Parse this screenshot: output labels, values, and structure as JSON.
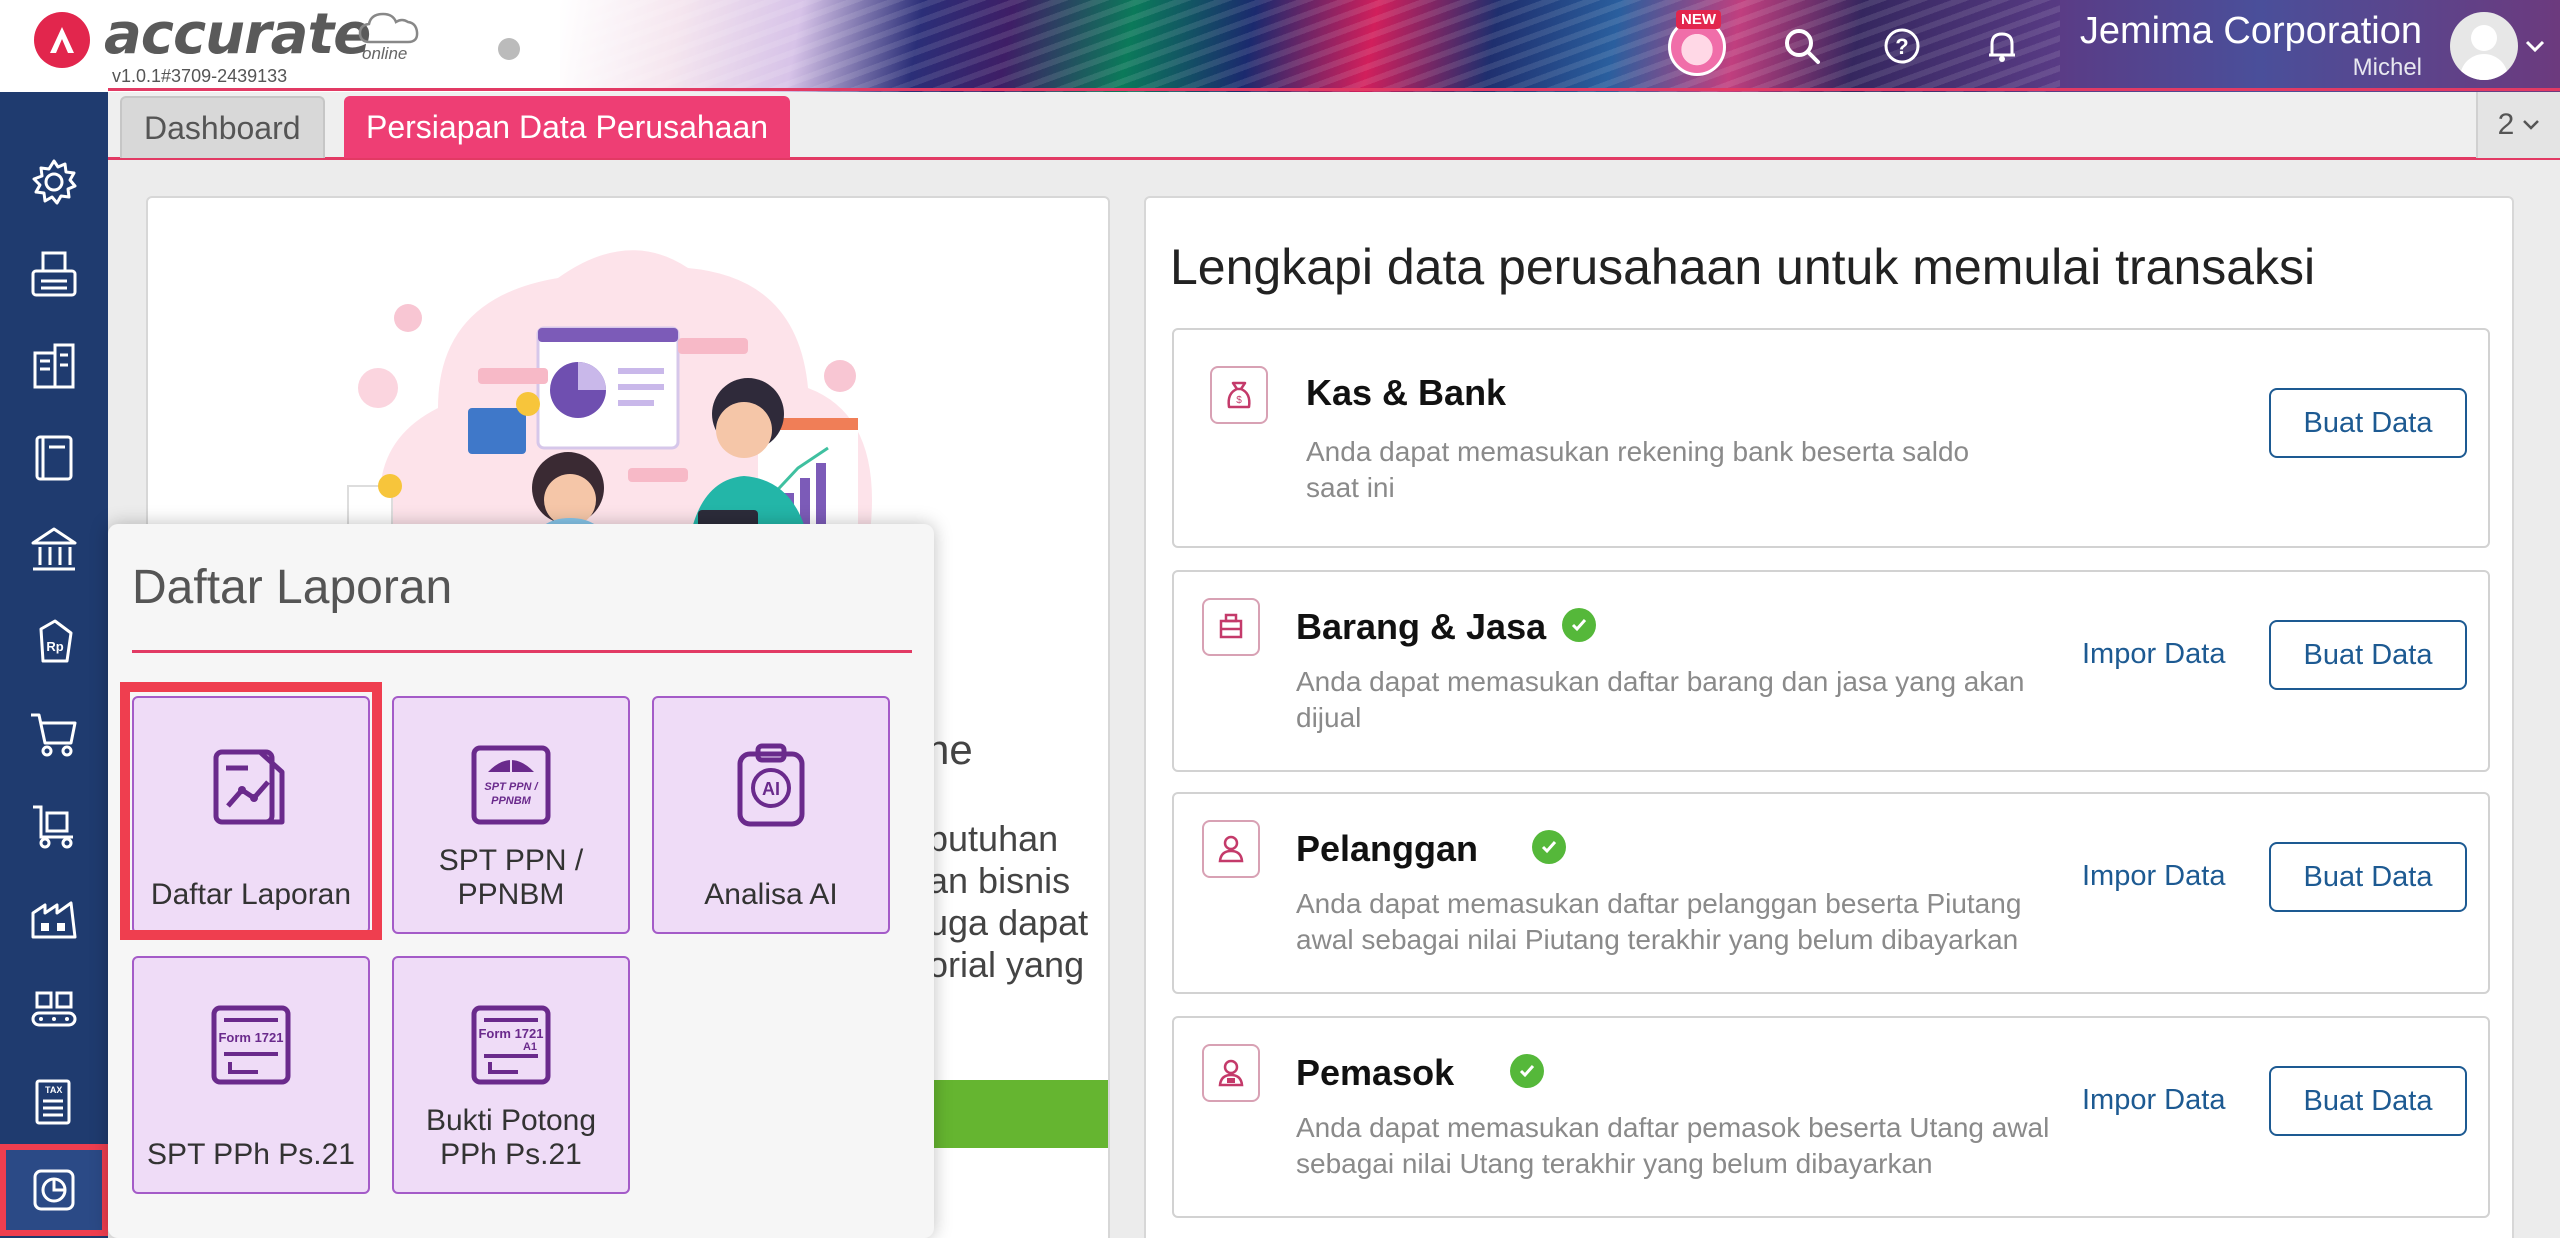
{
  "header": {
    "brand": "accurate",
    "brand_sub": "online",
    "version": "v1.0.1#3709-2439133",
    "new_badge": "NEW",
    "company": "Jemima Corporation",
    "user": "Michel"
  },
  "sidebar": {
    "items": [
      "gear-icon",
      "fax-icon",
      "building-icon",
      "book-icon",
      "bank-icon",
      "price-tag-icon",
      "cart-icon",
      "delivery-cart-icon",
      "factory-icon",
      "conveyor-icon",
      "tax-form-icon",
      "report-chart-icon"
    ]
  },
  "tabs": {
    "items": [
      {
        "label": "Dashboard"
      },
      {
        "label": "Persiapan Data Perusahaan"
      }
    ],
    "count": "2"
  },
  "left_card": {
    "partial_title": "ne",
    "partial_lines": [
      "butuhan",
      "an bisnis",
      "uga dapat",
      "orial yang"
    ]
  },
  "right_card": {
    "title": "Lengkapi data perusahaan untuk memulai transaksi",
    "entries": [
      {
        "title": "Kas & Bank",
        "desc": "Anda dapat memasukan rekening bank beserta saldo saat ini",
        "impor": "",
        "buat": "Buat Data"
      },
      {
        "title": "Barang & Jasa",
        "desc": "Anda dapat memasukan daftar barang dan jasa yang akan dijual",
        "impor": "Impor Data",
        "buat": "Buat Data"
      },
      {
        "title": "Pelanggan",
        "desc": "Anda dapat memasukan daftar pelanggan beserta Piutang awal sebagai nilai Piutang terakhir yang belum dibayarkan",
        "impor": "Impor Data",
        "buat": "Buat Data"
      },
      {
        "title": "Pemasok",
        "desc": "Anda dapat memasukan daftar pemasok beserta Utang awal sebagai nilai Utang terakhir yang belum dibayarkan",
        "impor": "Impor Data",
        "buat": "Buat Data"
      }
    ]
  },
  "popup": {
    "title": "Daftar Laporan",
    "tiles": [
      {
        "label": "Daftar Laporan",
        "icon": "report-chart-icon"
      },
      {
        "label": "SPT PPN / PPNBM",
        "icon": "spt-ppn-icon",
        "icon_text_1": "SPT PPN /",
        "icon_text_2": "PPNBM"
      },
      {
        "label": "Analisa AI",
        "icon": "ai-clipboard-icon",
        "icon_text": "AI"
      },
      {
        "label": "SPT PPh Ps.21",
        "icon": "form-1721-icon",
        "icon_text": "Form 1721"
      },
      {
        "label": "Bukti Potong PPh Ps.21",
        "icon": "form-1721-a1-icon",
        "icon_text_1": "Form 1721",
        "icon_text_2": "A1"
      }
    ]
  },
  "colors": {
    "accent": "#e23a64",
    "sidebar": "#1f3b6f",
    "link": "#1d5a92",
    "check": "#55b83a",
    "tile": "#efdcf7"
  }
}
